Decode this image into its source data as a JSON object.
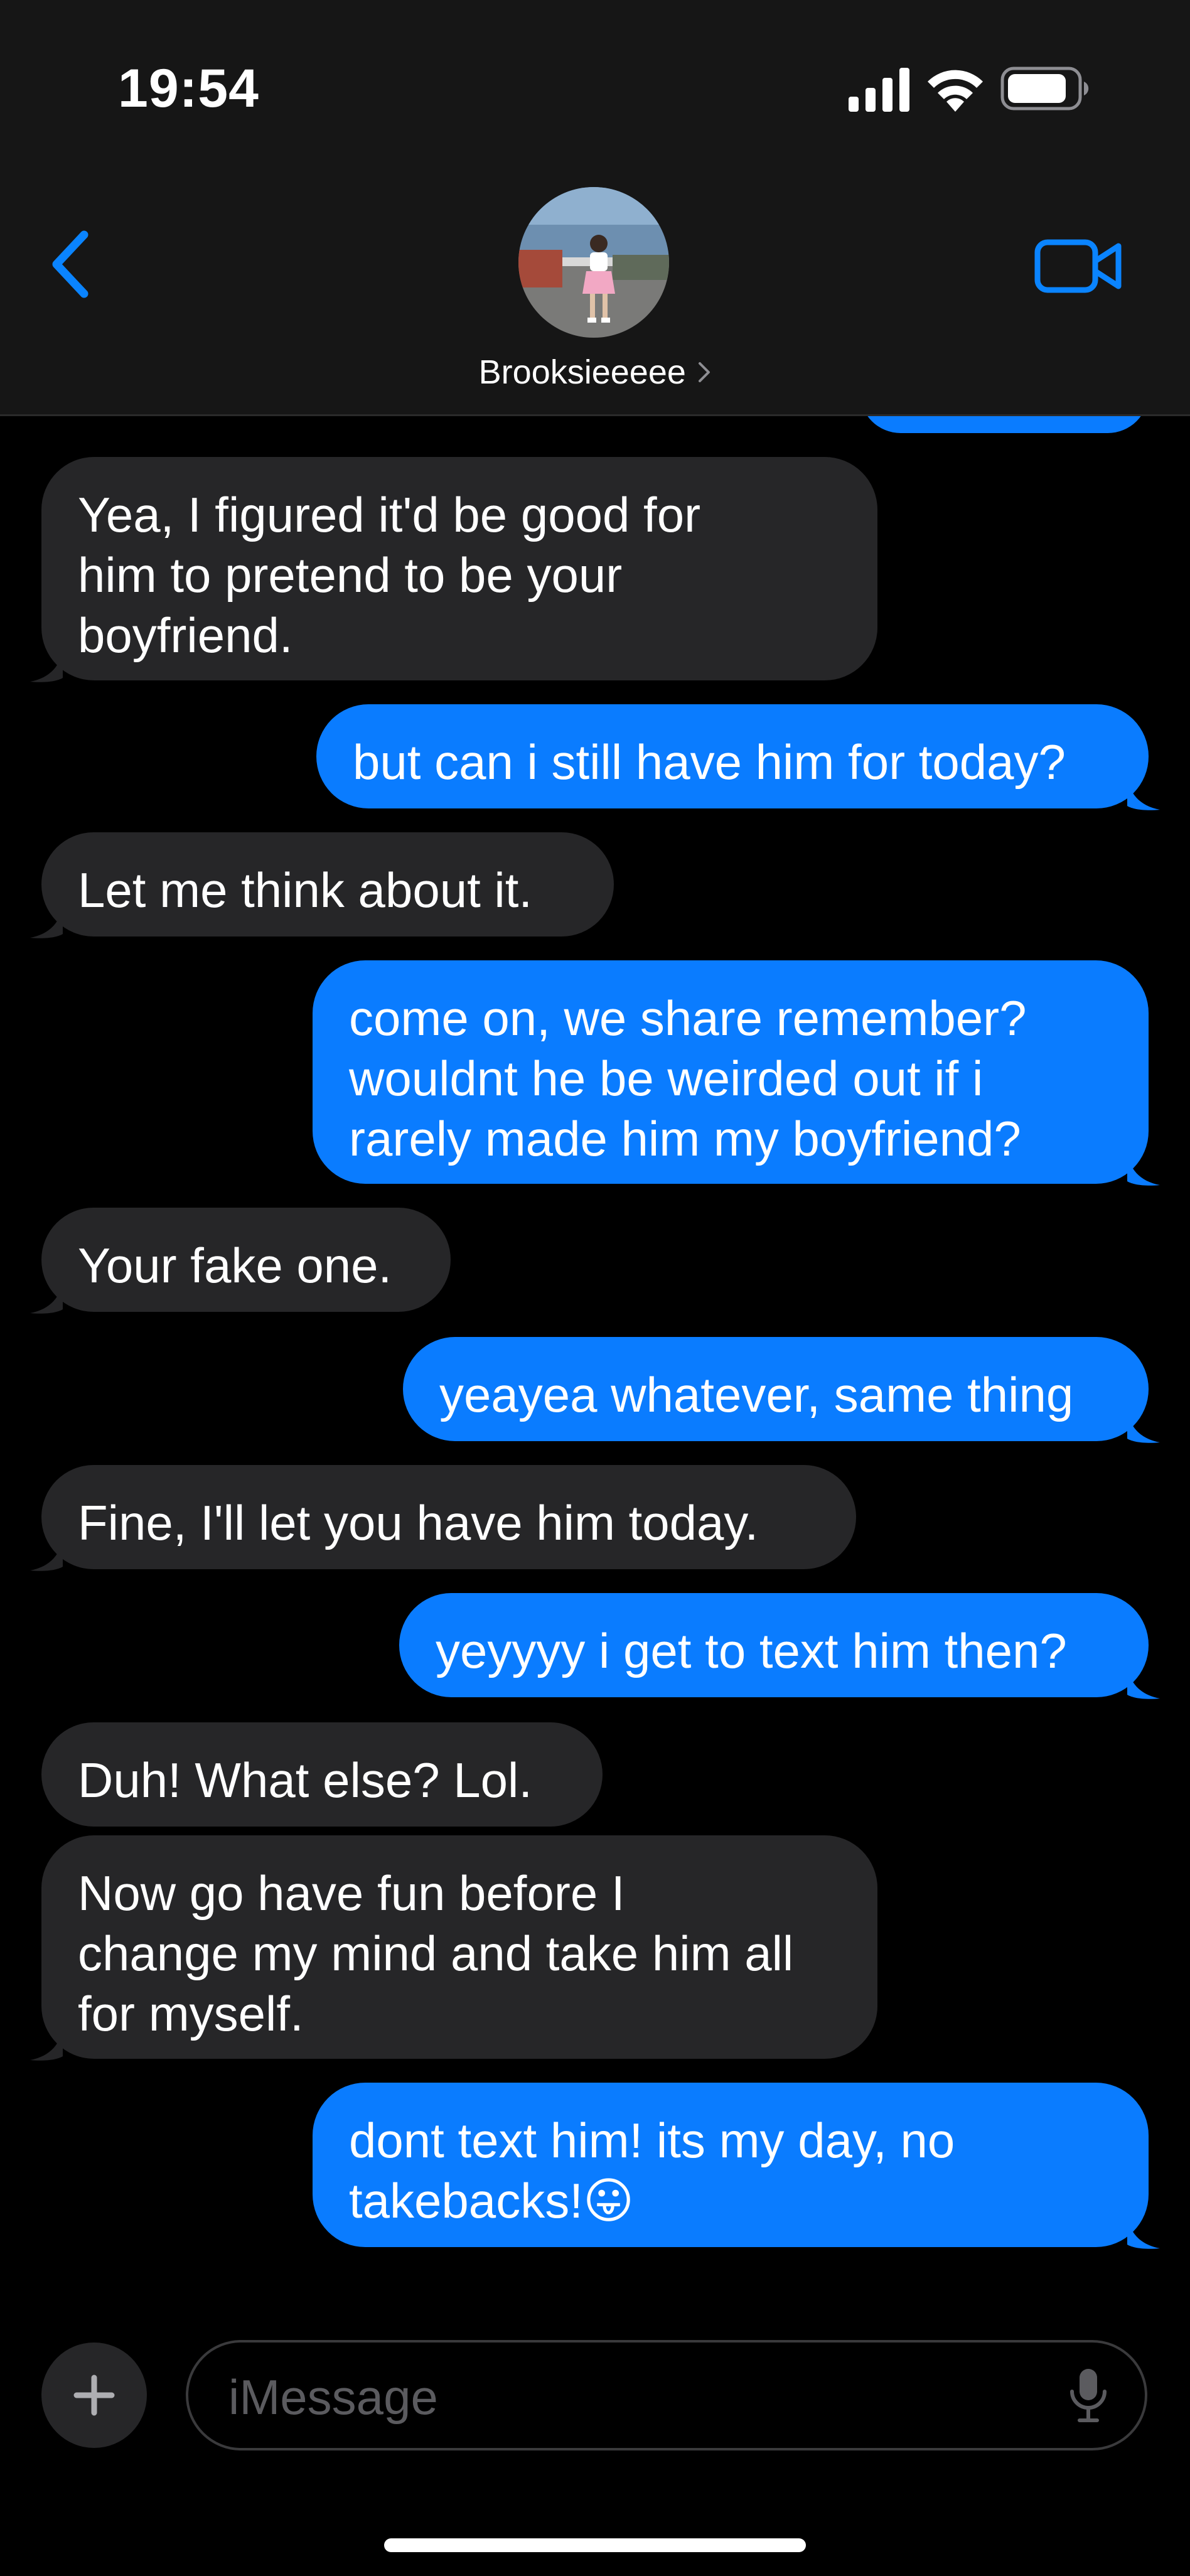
{
  "status_bar": {
    "time": "19:54",
    "signal_icon": "cellular-signal-icon",
    "wifi_icon": "wifi-icon",
    "battery_icon": "battery-icon"
  },
  "header": {
    "back_icon": "chevron-left-icon",
    "contact_name": "Brooksieeeee",
    "avatar": "contact-avatar-photo",
    "video_icon": "video-camera-icon"
  },
  "messages": [
    {
      "from": "contact",
      "lines": [
        "Yea, I figured it'd be good for",
        "him to pretend to be your",
        "boyfriend."
      ]
    },
    {
      "from": "me",
      "lines": [
        "but can i still have him for today?"
      ]
    },
    {
      "from": "contact",
      "lines": [
        "Let me think about it."
      ]
    },
    {
      "from": "me",
      "lines": [
        "come on, we share remember?",
        "wouldnt he be weirded out if i",
        "rarely made him my boyfriend?"
      ]
    },
    {
      "from": "contact",
      "lines": [
        "Your fake one."
      ]
    },
    {
      "from": "me",
      "lines": [
        "yeayea whatever, same thing"
      ]
    },
    {
      "from": "contact",
      "lines": [
        "Fine, I'll let you have him today."
      ]
    },
    {
      "from": "me",
      "lines": [
        "yeyyyy i get to text him then?"
      ]
    },
    {
      "from": "contact",
      "lines": [
        "Duh! What else? Lol."
      ]
    },
    {
      "from": "contact",
      "lines": [
        "Now go have fun before I",
        "change my mind and take him all",
        "for myself."
      ]
    },
    {
      "from": "me",
      "lines": [
        "dont text him! its my day, no",
        "takebacks!😛"
      ]
    }
  ],
  "input_bar": {
    "plus_icon": "plus-icon",
    "placeholder": "iMessage",
    "mic_icon": "microphone-icon"
  },
  "colors": {
    "background": "#000000",
    "header_background": "#161616",
    "sent_bubble": "#0a7cff",
    "received_bubble": "#262628",
    "accent": "#0a84ff"
  }
}
